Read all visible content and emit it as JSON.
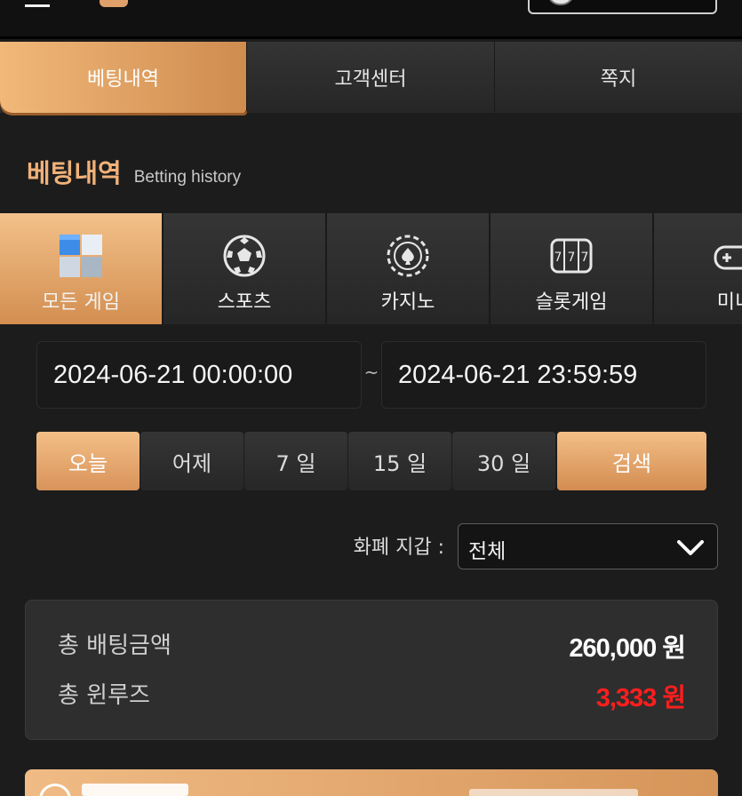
{
  "header": {
    "menu_icon": "hamburger-icon",
    "user_icon": "avatar-icon"
  },
  "main_tabs": [
    {
      "label": "베팅내역",
      "active": true
    },
    {
      "label": "고객센터",
      "active": false
    },
    {
      "label": "쪽지",
      "active": false
    }
  ],
  "section": {
    "title": "베팅내역",
    "subtitle": "Betting history"
  },
  "game_tabs": [
    {
      "label": "모든 게임",
      "icon": "all-games-cube-icon",
      "active": true
    },
    {
      "label": "스포츠",
      "icon": "soccer-ball-icon",
      "active": false
    },
    {
      "label": "카지노",
      "icon": "casino-chip-icon",
      "active": false
    },
    {
      "label": "슬롯게임",
      "icon": "slot-machine-icon",
      "active": false
    },
    {
      "label": "미니",
      "icon": "gamepad-icon",
      "active": false
    }
  ],
  "date_range": {
    "from": "2024-06-21 00:00:00",
    "separator": "~",
    "to": "2024-06-21 23:59:59"
  },
  "period_buttons": [
    {
      "label": "오늘",
      "active": true
    },
    {
      "label": "어제",
      "active": false
    },
    {
      "label": "7 일",
      "active": false
    },
    {
      "label": "15 일",
      "active": false
    },
    {
      "label": "30 일",
      "active": false
    }
  ],
  "search_label": "검색",
  "wallet": {
    "label": "화폐 지갑 :",
    "selected": "전체"
  },
  "summary": {
    "total_bet_label": "총 배팅금액",
    "total_bet_value": "260,000 원",
    "total_winloss_label": "총 윈루즈",
    "total_winloss_value": "3,333 원"
  },
  "colors": {
    "accent": "#e0a06a",
    "background": "#1c1c1c",
    "negative": "#ff1e1e"
  }
}
